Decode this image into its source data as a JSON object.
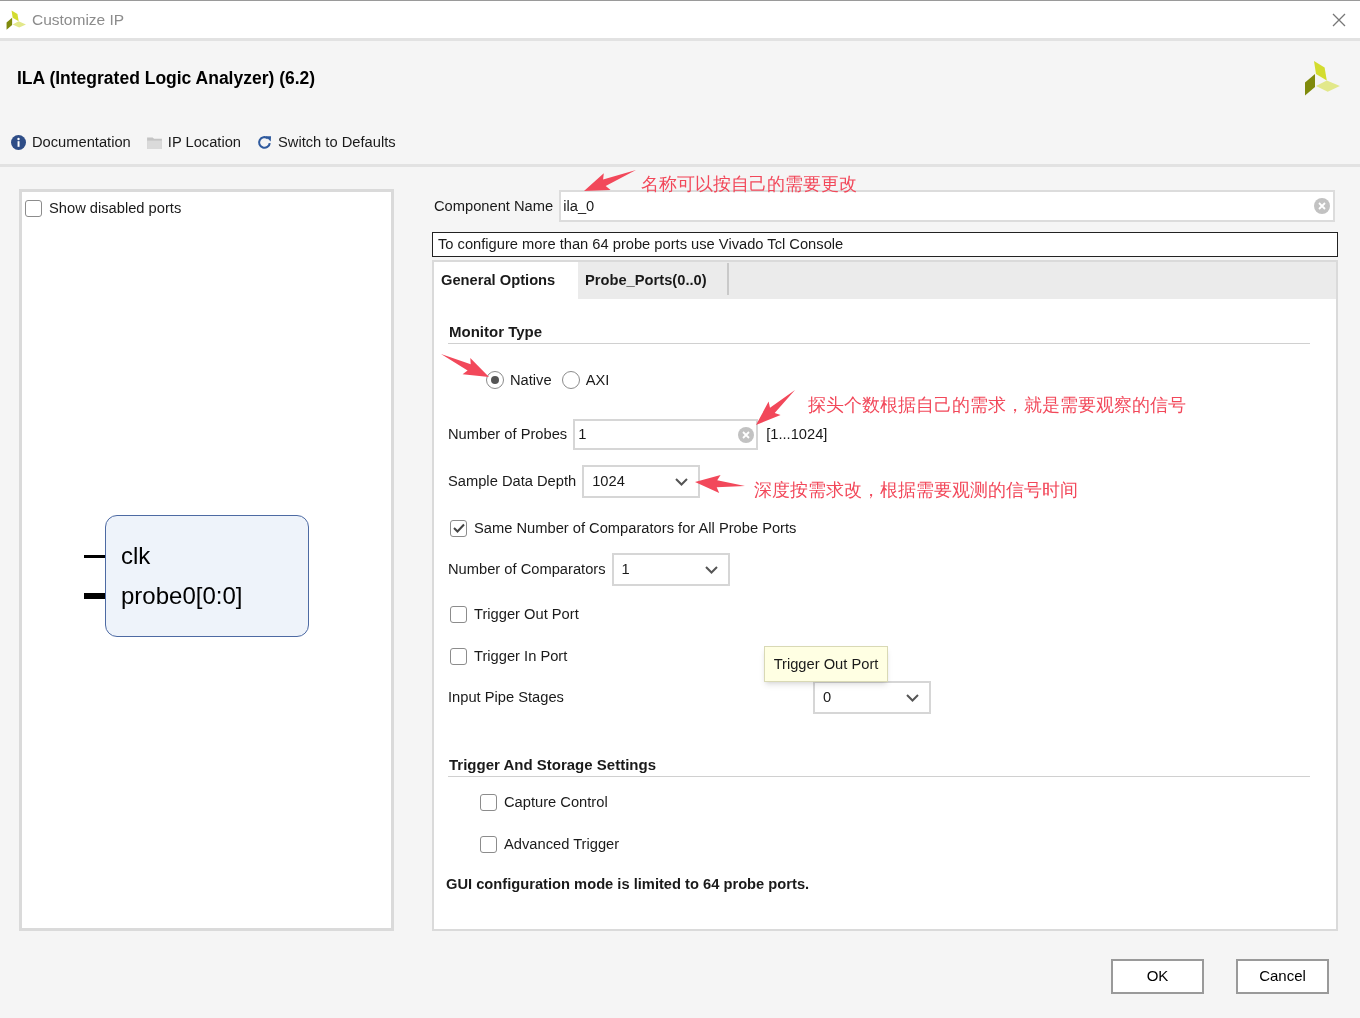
{
  "window": {
    "title": "Customize IP"
  },
  "header": {
    "title": "ILA (Integrated Logic Analyzer) (6.2)",
    "links": [
      {
        "kind": "info",
        "label": "Documentation"
      },
      {
        "kind": "folder",
        "label": "IP Location"
      },
      {
        "kind": "refresh",
        "label": "Switch to Defaults"
      }
    ]
  },
  "symbol_panel": {
    "show_disabled_ports": {
      "label": "Show disabled ports",
      "checked": false
    },
    "ports": [
      {
        "kind": "wire",
        "name": "clk"
      },
      {
        "kind": "bus",
        "name": "probe0[0:0]"
      }
    ]
  },
  "component_name": {
    "label": "Component Name",
    "value": "ila_0"
  },
  "info_message": "To configure more than 64 probe ports use Vivado Tcl Console",
  "tabs": [
    {
      "label": "General Options",
      "selected": true
    },
    {
      "label": "Probe_Ports(0..0)",
      "selected": false
    }
  ],
  "general_options": {
    "monitor_type": {
      "heading": "Monitor Type",
      "options": [
        {
          "label": "Native",
          "selected": true
        },
        {
          "label": "AXI",
          "selected": false
        }
      ]
    },
    "fields": [
      {
        "kind": "text",
        "label": "Number of Probes",
        "value": "1",
        "range": "[1...1024]"
      },
      {
        "kind": "select",
        "label": "Sample Data Depth",
        "value": "1024"
      },
      {
        "kind": "checkbox",
        "label": "Same Number of Comparators for All Probe Ports",
        "checked": true
      },
      {
        "kind": "select",
        "label": "Number of Comparators",
        "value": "1"
      },
      {
        "kind": "checkbox",
        "label": "Trigger Out Port",
        "checked": false
      },
      {
        "kind": "checkbox",
        "label": "Trigger In Port",
        "checked": false
      },
      {
        "kind": "select",
        "label": "Input Pipe Stages",
        "value": "0"
      }
    ],
    "trigger_storage": {
      "heading": "Trigger And Storage Settings",
      "options": [
        {
          "label": "Capture Control",
          "checked": false
        },
        {
          "label": "Advanced Trigger",
          "checked": false
        }
      ]
    },
    "note": "GUI configuration mode is limited to 64 probe ports."
  },
  "tooltip": "Trigger Out Port",
  "annotations": [
    {
      "kind": "arrow_note",
      "text": "名称可以按自己的需要更改"
    },
    {
      "kind": "arrow"
    },
    {
      "kind": "arrow_note",
      "text": "探头个数根据自己的需求，就是需要观察的信号"
    },
    {
      "kind": "arrow_note",
      "text": "深度按需求改，根据需要观测的信号时间"
    }
  ],
  "buttons": [
    "OK",
    "Cancel"
  ]
}
